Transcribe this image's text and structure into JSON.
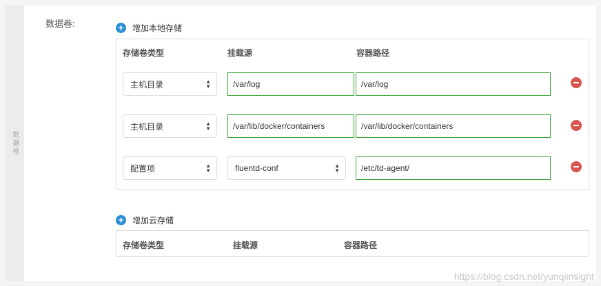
{
  "side_label": "数据卷",
  "section_label": "数据卷:",
  "local": {
    "add_label": "增加本地存储",
    "headers": {
      "type": "存储卷类型",
      "source": "挂载源",
      "path": "容器路径"
    },
    "rows": [
      {
        "type": "主机目录",
        "source": "/var/log",
        "path": "/var/log"
      },
      {
        "type": "主机目录",
        "source": "/var/lib/docker/containers",
        "path": "/var/lib/docker/containers"
      },
      {
        "type": "配置项",
        "source": "fluentd-conf",
        "path": "/etc/td-agent/"
      }
    ]
  },
  "cloud": {
    "add_label": "增加云存储",
    "headers": {
      "type": "存储卷类型",
      "source": "挂载源",
      "path": "容器路径"
    }
  },
  "watermark": "https://blog.csdn.net/yunqiinsight",
  "colors": {
    "accent": "#2b8fd6",
    "valid_border": "#3aa53a",
    "danger": "#d9534f"
  }
}
